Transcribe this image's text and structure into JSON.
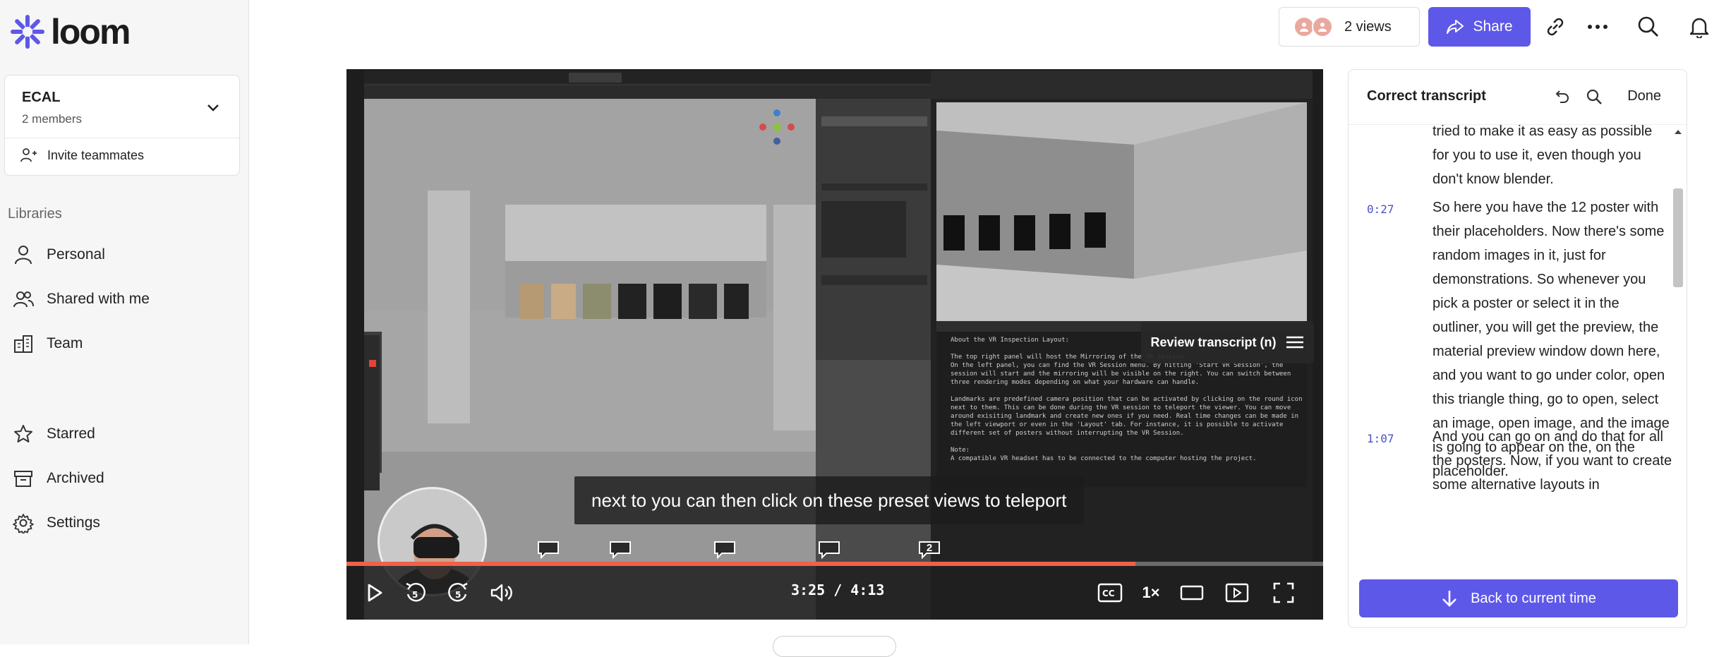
{
  "app": {
    "name": "loom"
  },
  "workspace": {
    "name": "ECAL",
    "members": "2 members",
    "invite": "Invite teammates"
  },
  "sidebar": {
    "libraries_heading": "Libraries",
    "items": [
      {
        "label": "Personal",
        "icon": "person-icon"
      },
      {
        "label": "Shared with me",
        "icon": "people-icon"
      },
      {
        "label": "Team",
        "icon": "building-icon"
      }
    ],
    "bottom_items": [
      {
        "label": "Starred",
        "icon": "star-icon"
      },
      {
        "label": "Archived",
        "icon": "archive-icon"
      },
      {
        "label": "Settings",
        "icon": "gear-icon"
      }
    ]
  },
  "topbar": {
    "views": "2 views",
    "share": "Share"
  },
  "video": {
    "caption": "next to you can then click on these preset views to teleport",
    "review_chip": "Review transcript (n)",
    "time": "3:25 / 4:13",
    "speed": "1×",
    "progress": 0.808,
    "comment_count": "2",
    "blender_text": "About the VR Inspection Layout:\n\nThe top right panel will host the Mirroring of the VR session.\nOn the left panel, you can find the VR Session menu. By hitting 'Start VR Session', the\nsession will start and the mirroring will be visible on the right. You can switch between\nthree rendering modes depending on what your hardware can handle.\n\nLandmarks are predefined camera position that can be activated by clicking on the round icon\nnext to them. This can be done during the VR session to teleport the viewer. You can move\naround exisiting landmark and create new ones if you need. Real time changes can be made in\nthe left viewport or even in the 'Layout' tab. For instance, it is possible to activate\ndifferent set of posters without interrupting the VR Session.\n\nNote:\nA compatible VR headset has to be connected to the computer hosting the project."
  },
  "transcript": {
    "title": "Correct transcript",
    "done": "Done",
    "segments": [
      {
        "time": "",
        "text": "tried to make it as easy as possible for you to use it, even though you don't know blender."
      },
      {
        "time": "0:27",
        "text": "So here you have the 12 poster with their placeholders. Now there's some random images in it, just for demonstrations. So whenever you pick a poster or select it in the outliner, you will get the preview, the material preview window down here, and you want to go under color, open this triangle thing, go to open, select an image, open image, and the image is going to appear on the, on the placeholder."
      },
      {
        "time": "1:07",
        "text": "And you can go on and do that for all the posters. Now, if you want to create some alternative layouts in"
      }
    ],
    "back_button": "Back to current time"
  },
  "colors": {
    "accent": "#5e58e8",
    "progress": "#f0604a",
    "logo": "#5e58e8"
  }
}
